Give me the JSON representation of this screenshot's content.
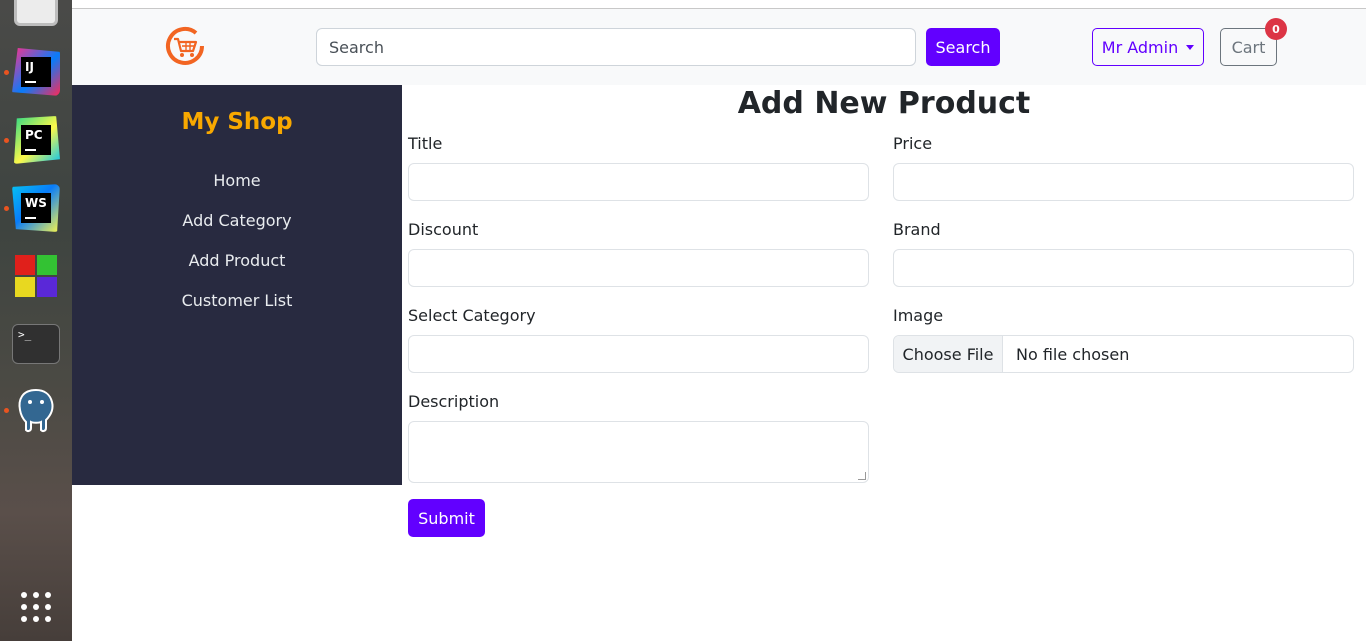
{
  "dock": {
    "apps": [
      {
        "name": "intellij-idea",
        "label": "IJ"
      },
      {
        "name": "pycharm",
        "label": "PC"
      },
      {
        "name": "webstorm",
        "label": "WS"
      },
      {
        "name": "terminal",
        "label": ">_"
      }
    ]
  },
  "navbar": {
    "search_placeholder": "Search",
    "search_button": "Search",
    "admin_label": "Mr Admin",
    "cart_label": "Cart",
    "cart_count": "0"
  },
  "sidebar": {
    "brand": "My Shop",
    "items": [
      "Home",
      "Add Category",
      "Add Product",
      "Customer List"
    ]
  },
  "form": {
    "title": "Add New Product",
    "labels": {
      "title": "Title",
      "price": "Price",
      "discount": "Discount",
      "brand": "Brand",
      "category": "Select Category",
      "image": "Image",
      "description": "Description"
    },
    "file_button": "Choose File",
    "file_status": "No file chosen",
    "submit": "Submit"
  },
  "colors": {
    "accent": "#6200ff",
    "brand": "#f8a800",
    "sidebar": "#282a40",
    "badge": "#dc3545"
  }
}
